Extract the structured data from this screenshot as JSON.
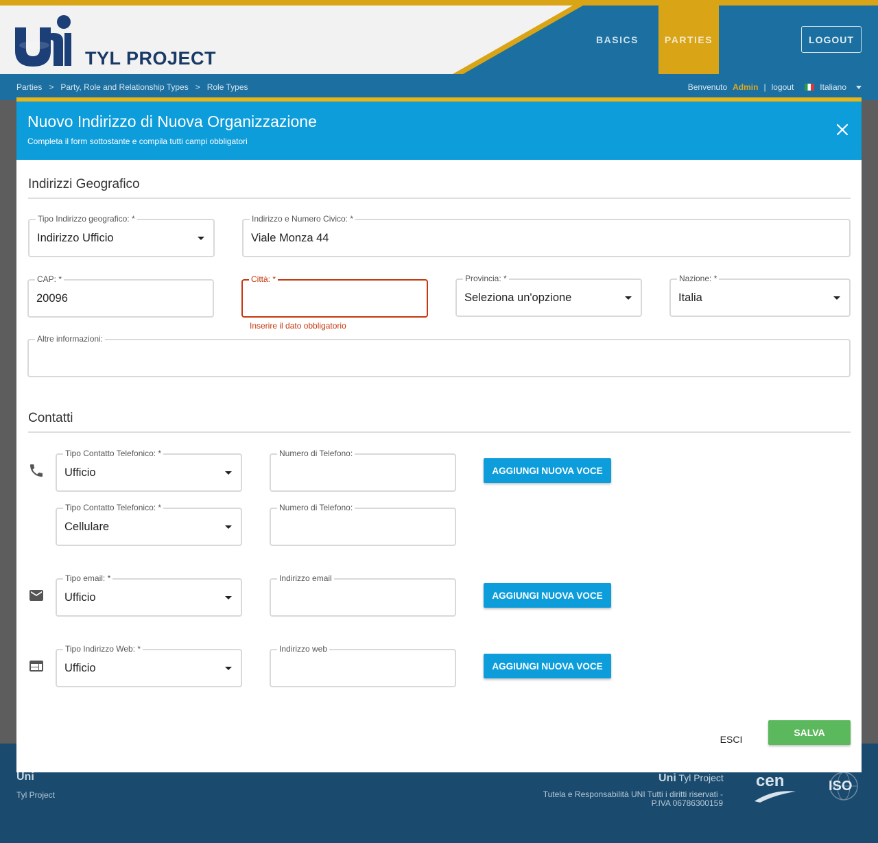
{
  "header": {
    "brand": "TYL PROJECT",
    "nav": [
      "BASICS",
      "PARTIES"
    ],
    "logout_button": "LOGOUT"
  },
  "breadcrumb": {
    "items": [
      "Parties",
      "Party, Role and Relationship Types",
      "Role Types"
    ],
    "separator": ">"
  },
  "userbar": {
    "welcome": "Benvenuto",
    "user": "Admin",
    "divider": "|",
    "logout_link": "logout",
    "language": "Italiano"
  },
  "dialog": {
    "title": "Nuovo Indirizzo di Nuova Organizzazione",
    "subtitle": "Completa il form sottostante e compila tutti campi obbligatori",
    "close_icon": "close-icon",
    "section_geo": "Indirizzi Geografico",
    "geo": {
      "tipo_label": "Tipo Indirizzo geografico: *",
      "tipo_value": "Indirizzo Ufficio",
      "indirizzo_label": "Indirizzo e Numero Civico: *",
      "indirizzo_value": "Viale Monza 44",
      "cap_label": "CAP: *",
      "cap_value": "20096",
      "citta_label": "Città: *",
      "citta_value": "",
      "citta_error": "Inserire il dato obbligatorio",
      "provincia_label": "Provincia: *",
      "provincia_value": "Seleziona un'opzione",
      "nazione_label": "Nazione: *",
      "nazione_value": "Italia",
      "altre_label": "Altre informazioni:",
      "altre_value": ""
    },
    "section_contatti": "Contatti",
    "contacts": {
      "phone_icon": "phone-icon",
      "phone1_type_label": "Tipo Contatto Telefonico: *",
      "phone1_type_value": "Ufficio",
      "phone1_number_label": "Numero di Telefono:",
      "phone2_type_label": "Tipo Contatto Telefonico: *",
      "phone2_type_value": "Cellulare",
      "phone2_number_label": "Numero di Telefono:",
      "email_icon": "mail-icon",
      "email_type_label": "Tipo email: *",
      "email_type_value": "Ufficio",
      "email_address_label": "Indirizzo email",
      "web_icon": "web-icon",
      "web_type_label": "Tipo Indirizzo Web: *",
      "web_type_value": "Ufficio",
      "web_address_label": "Indirizzo web",
      "add_button": "AGGIUNGI NUOVA VOCE"
    },
    "esci_button": "ESCI",
    "salva_button": "SALVA"
  },
  "footer": {
    "left_title": "Uni",
    "left_sub": "Tyl Project",
    "right_title_bold": "Uni",
    "right_title": "Tyl Project",
    "copyright": "Tutela e Responsabilità UNI Tutti i diritti riservati - P.IVA 06786300159",
    "logos": [
      "cen-logo",
      "iso-logo"
    ]
  },
  "colors": {
    "header_blue": "#1b70a1",
    "accent_gold": "#d9a416",
    "dialog_header": "#0d9ddb",
    "error": "#c4380f",
    "save_green": "#5cb85c"
  }
}
